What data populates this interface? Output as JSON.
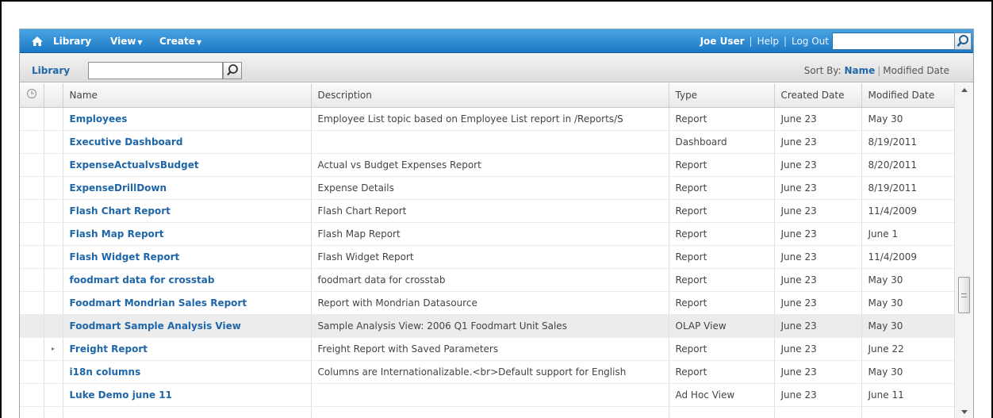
{
  "topbar": {
    "nav": [
      {
        "label": "Library",
        "dropdown": false
      },
      {
        "label": "View",
        "dropdown": true
      },
      {
        "label": "Create",
        "dropdown": true
      }
    ],
    "user": "Joe User",
    "help": "Help",
    "logout": "Log Out",
    "search_value": ""
  },
  "library": {
    "title": "Library",
    "search_value": "",
    "sort_label": "Sort By:",
    "sort_name": "Name",
    "sort_modified": "Modified Date"
  },
  "table": {
    "columns": [
      "",
      "",
      "Name",
      "Description",
      "Type",
      "Created Date",
      "Modified Date"
    ],
    "rows": [
      {
        "name": "Employees",
        "description": "Employee List topic based on Employee List report in /Reports/S",
        "type": "Report",
        "created": "June 23",
        "modified": "May 30",
        "expander": ""
      },
      {
        "name": "Executive Dashboard",
        "description": "",
        "type": "Dashboard",
        "created": "June 23",
        "modified": "8/19/2011",
        "expander": ""
      },
      {
        "name": "ExpenseActualvsBudget",
        "description": "Actual vs Budget Expenses Report",
        "type": "Report",
        "created": "June 23",
        "modified": "8/20/2011",
        "expander": ""
      },
      {
        "name": "ExpenseDrillDown",
        "description": "Expense Details",
        "type": "Report",
        "created": "June 23",
        "modified": "8/19/2011",
        "expander": ""
      },
      {
        "name": "Flash Chart Report",
        "description": "Flash Chart Report",
        "type": "Report",
        "created": "June 23",
        "modified": "11/4/2009",
        "expander": ""
      },
      {
        "name": "Flash Map Report",
        "description": "Flash Map Report",
        "type": "Report",
        "created": "June 23",
        "modified": "June 1",
        "expander": ""
      },
      {
        "name": "Flash Widget Report",
        "description": "Flash Widget Report",
        "type": "Report",
        "created": "June 23",
        "modified": "11/4/2009",
        "expander": ""
      },
      {
        "name": "foodmart data for crosstab",
        "description": "foodmart data for crosstab",
        "type": "Report",
        "created": "June 23",
        "modified": "May 30",
        "expander": ""
      },
      {
        "name": "Foodmart Mondrian Sales Report",
        "description": "Report with Mondrian Datasource",
        "type": "Report",
        "created": "June 23",
        "modified": "May 30",
        "expander": ""
      },
      {
        "name": "Foodmart Sample Analysis View",
        "description": "Sample Analysis View: 2006 Q1 Foodmart Unit Sales",
        "type": "OLAP View",
        "created": "June 23",
        "modified": "May 30",
        "expander": "",
        "selected": true
      },
      {
        "name": "Freight Report",
        "description": "Freight Report with Saved Parameters",
        "type": "Report",
        "created": "June 23",
        "modified": "June 22",
        "expander": "▸"
      },
      {
        "name": "i18n columns",
        "description": "Columns are Internationalizable.<br>Default support for English",
        "type": "Report",
        "created": "June 23",
        "modified": "May 30",
        "expander": ""
      },
      {
        "name": "Luke Demo june 11",
        "description": "",
        "type": "Ad Hoc View",
        "created": "June 23",
        "modified": "June 11",
        "expander": ""
      },
      {
        "name": "",
        "description": "",
        "type": "",
        "created": "",
        "modified": "",
        "expander": ""
      }
    ]
  },
  "colors": {
    "topbar": "#1d79c4",
    "link": "#1f66a9",
    "selected_row": "#ececec"
  }
}
